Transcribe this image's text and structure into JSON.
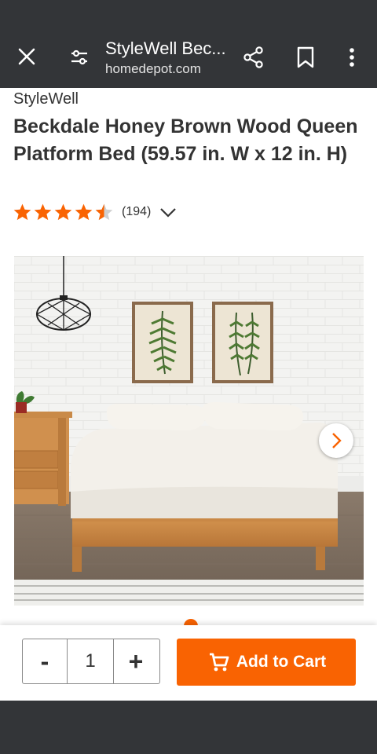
{
  "browser": {
    "page_title": "StyleWell Bec...",
    "url": "homedepot.com",
    "icons": [
      "close-icon",
      "tune-icon",
      "share-icon",
      "bookmark-icon",
      "more-vert-icon"
    ]
  },
  "product": {
    "brand": "StyleWell",
    "title": "Beckdale Honey Brown Wood Queen Platform Bed (59.57 in. W x 12 in. H)",
    "rating": 4.5,
    "review_count": "(194)"
  },
  "gallery": {
    "next_icon": "chevron-right-icon"
  },
  "cart": {
    "minus_label": "-",
    "quantity": "1",
    "plus_label": "+",
    "add_to_cart_label": "Add to Cart"
  },
  "colors": {
    "brand_orange": "#f96302",
    "bar_dark": "#333538",
    "star": "#f96302"
  }
}
